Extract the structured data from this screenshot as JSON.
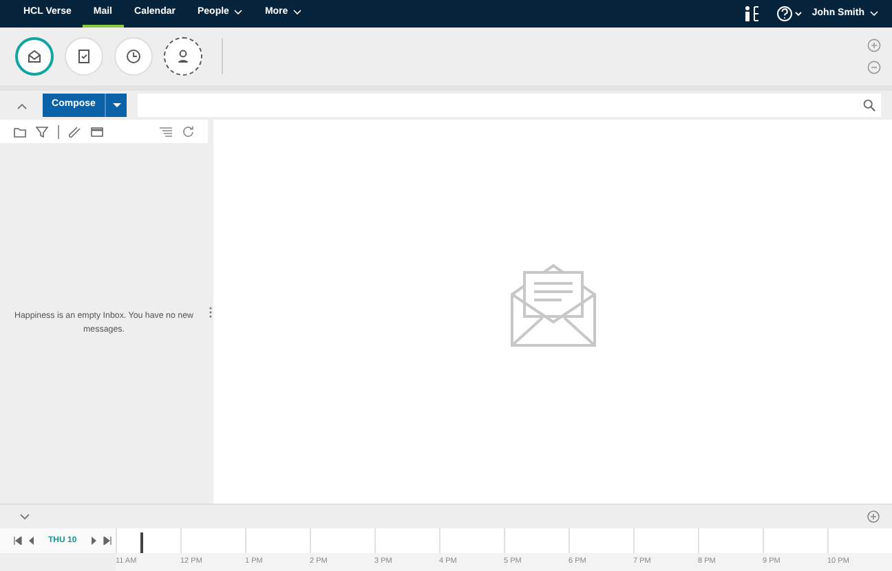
{
  "nav": {
    "items": [
      {
        "label": "HCL Verse",
        "selected": false,
        "has_menu": false
      },
      {
        "label": "Mail",
        "selected": true,
        "has_menu": false
      },
      {
        "label": "Calendar",
        "selected": false,
        "has_menu": false
      },
      {
        "label": "People",
        "selected": false,
        "has_menu": true
      },
      {
        "label": "More",
        "selected": false,
        "has_menu": true
      }
    ],
    "user": "John Smith"
  },
  "bubbles": [
    {
      "kind": "mail",
      "selected": true
    },
    {
      "kind": "tasks",
      "selected": false
    },
    {
      "kind": "clock",
      "selected": false
    },
    {
      "kind": "person",
      "selected": false
    }
  ],
  "compose": {
    "label": "Compose"
  },
  "inbox": {
    "empty_message": "Happiness is an empty Inbox. You have no new messages."
  },
  "timeline": {
    "day": "THU 10",
    "hours": [
      "11 AM",
      "12 PM",
      "1 PM",
      "2 PM",
      "3 PM",
      "4 PM",
      "5 PM",
      "6 PM",
      "7 PM",
      "8 PM",
      "9 PM",
      "10 PM"
    ]
  }
}
